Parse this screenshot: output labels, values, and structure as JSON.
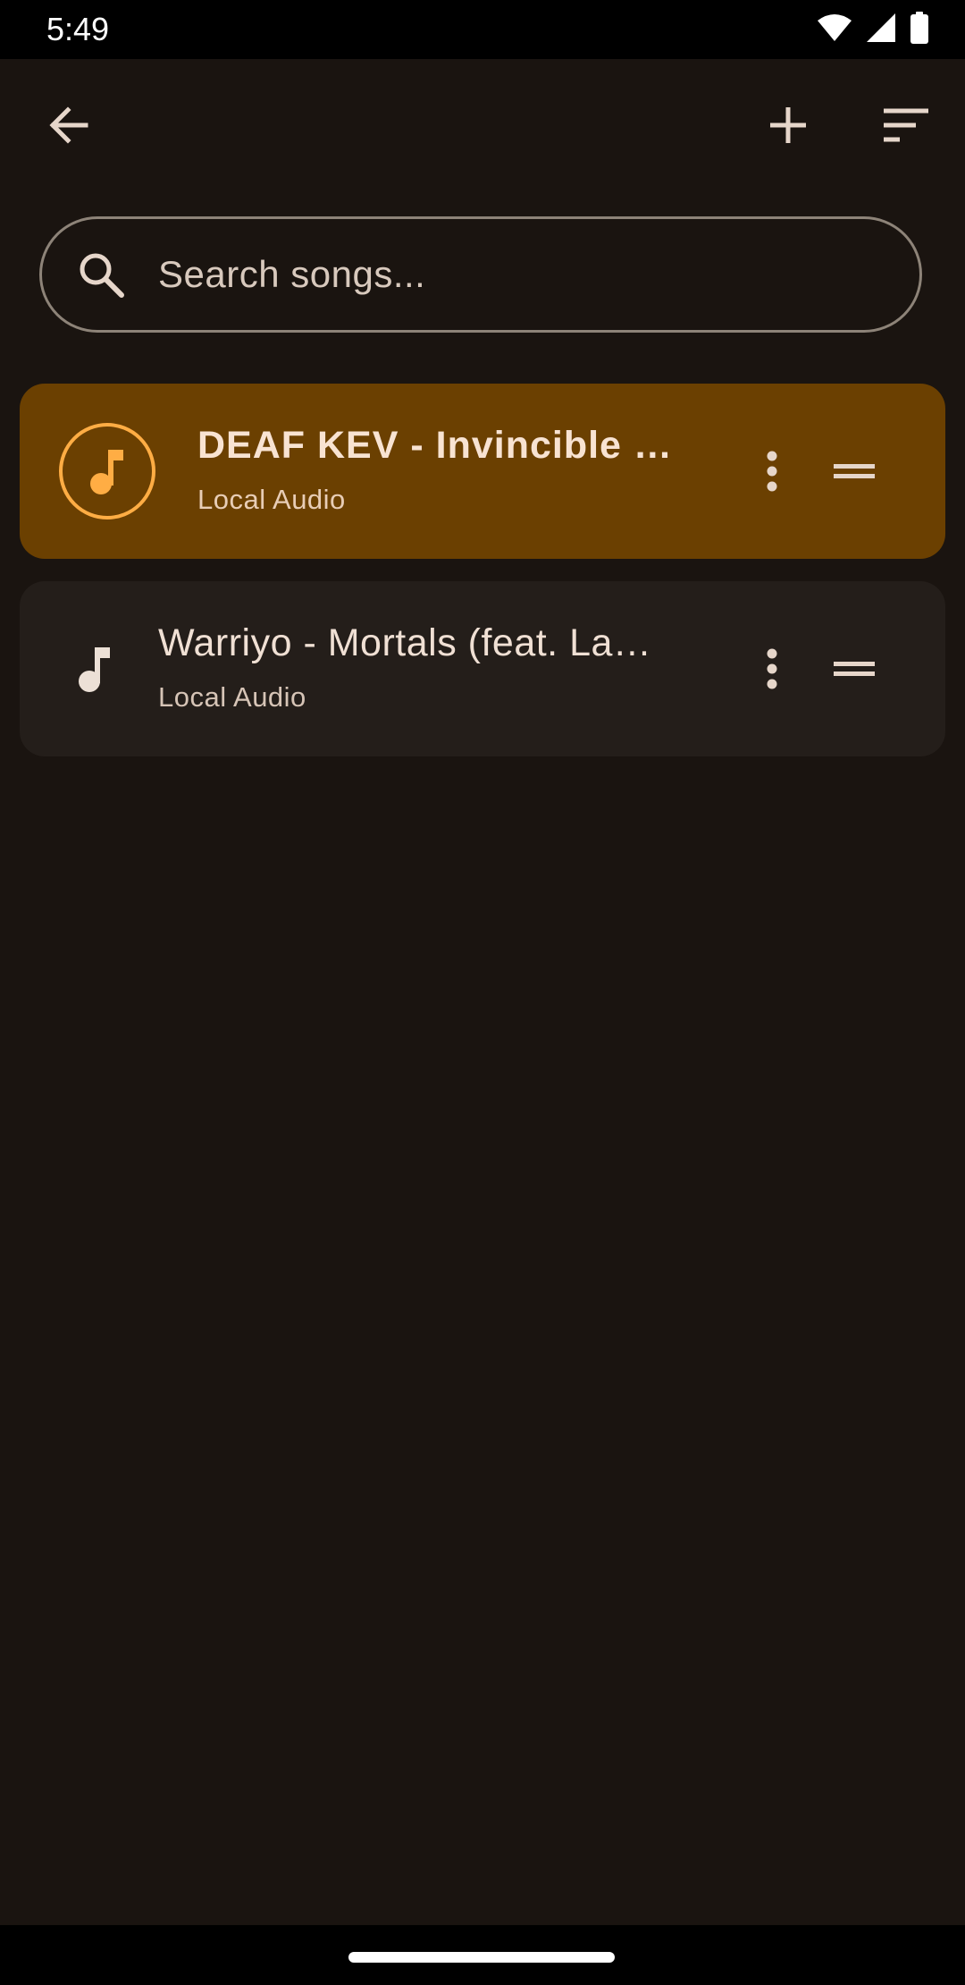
{
  "status_bar": {
    "time": "5:49",
    "icons": [
      "wifi-icon",
      "cellular-signal-icon",
      "battery-icon"
    ]
  },
  "app_bar": {
    "back_icon": "arrow-left-icon",
    "add_icon": "plus-icon",
    "sort_icon": "sort-icon"
  },
  "search": {
    "placeholder": "Search songs...",
    "value": ""
  },
  "tracks": [
    {
      "title": "DEAF KEV - Invincible  …",
      "subtitle": "Local Audio",
      "playing": true
    },
    {
      "title": "Warriyo - Mortals (feat. La…",
      "subtitle": "Local Audio",
      "playing": false
    }
  ],
  "colors": {
    "background": "#1a1410",
    "active_track": "#6b4001",
    "track": "#241e1a",
    "accent": "#ffad44"
  }
}
